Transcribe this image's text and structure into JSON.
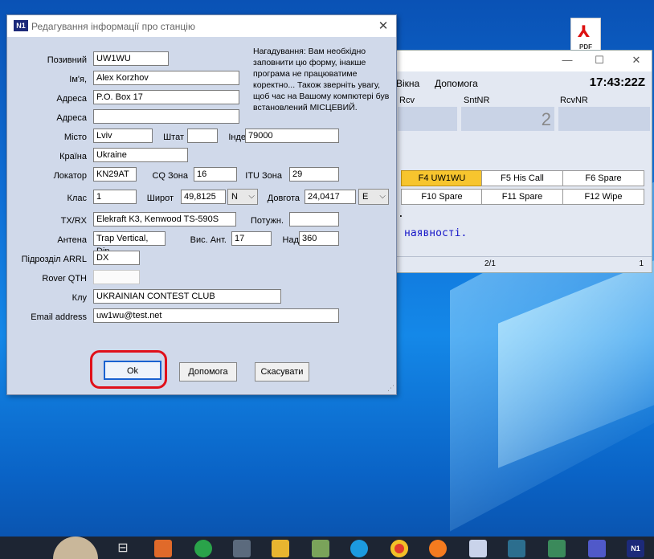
{
  "dialog": {
    "title": "Редагування інформації про станцію",
    "reminder": "Нагадування: Вам необхідно заповнити цю форму, інакше програма не працюватиме коректно... Також зверніть увагу, щоб час на Вашому компютері був встановлений МІСЦЕВИЙ.",
    "labels": {
      "callsign": "Позивний",
      "name": "Ім'я,",
      "address1": "Адреса",
      "address2": "Адреса",
      "city": "Місто",
      "state": "Штат",
      "zip": "Індe",
      "country": "Країна",
      "locator": "Локатор",
      "cq_zone": "CQ Зона",
      "itu_zone": "ITU Зона",
      "class": "Клас",
      "latitude": "Широт",
      "longitude": "Довгота",
      "txrx": "TX/RX",
      "power": "Потужн.",
      "antenna": "Антена",
      "ant_height": "Вис. Ант.",
      "above": "Над",
      "arrl_section": "Підрозділ ARRL",
      "rover_qth": "Rover QTH",
      "club": "Клу",
      "email": "Email address"
    },
    "values": {
      "callsign": "UW1WU",
      "name": "Alex Korzhov",
      "address1": "P.O. Box 17",
      "address2": "",
      "city": "Lviv",
      "state": "",
      "zip": "79000",
      "country": "Ukraine",
      "locator": "KN29AT",
      "cq_zone": "16",
      "itu_zone": "29",
      "class": "1",
      "latitude": "49,8125",
      "lat_dir": "N",
      "longitude": "24,0417",
      "lon_dir": "E",
      "txrx": "Elekraft K3, Kenwood TS-590S",
      "power": "",
      "antenna": "Trap Vertical, Dip",
      "ant_height": "17",
      "above": "360",
      "arrl_section": "DX",
      "rover_qth": "",
      "club": "UKRAINIAN CONTEST CLUB",
      "email": "uw1wu@test.net"
    },
    "buttons": {
      "ok": "Ok",
      "help": "Допомога",
      "cancel": "Скасувати"
    }
  },
  "bg_window": {
    "menu": [
      "Вікна",
      "Допомога"
    ],
    "clock": "17:43:22Z",
    "columns": [
      "Rcv",
      "SntNR",
      "RcvNR"
    ],
    "sntnr_value": "2",
    "fkeys_row1": [
      "F4 UW1WU",
      "F5 His Call",
      "F6 Spare"
    ],
    "fkeys_row2": [
      "F10 Spare",
      "F11 Spare",
      "F12 Wipe"
    ],
    "dot_text": ".",
    "message": "наявності.",
    "status_mid": "2/1",
    "status_right": "1"
  },
  "desktop": {
    "pdf_label": "PDF"
  },
  "colors": {
    "accent": "#1a62d0",
    "highlight": "#e0101a",
    "active_fkey": "#f7c52e"
  }
}
